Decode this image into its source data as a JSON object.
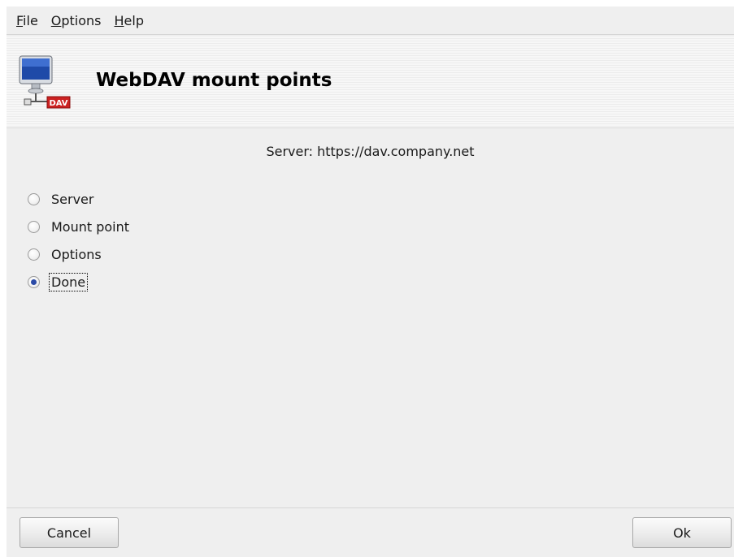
{
  "menubar": {
    "file": {
      "mnemonic": "F",
      "rest": "ile"
    },
    "options": {
      "mnemonic": "O",
      "rest": "ptions"
    },
    "help": {
      "mnemonic": "H",
      "rest": "elp"
    }
  },
  "banner": {
    "icon": "webdav-monitor-icon",
    "badge_text": "DAV",
    "title": "WebDAV mount points"
  },
  "server_line": "Server: https://dav.company.net",
  "radios": [
    {
      "label": "Server",
      "checked": false
    },
    {
      "label": "Mount point",
      "checked": false
    },
    {
      "label": "Options",
      "checked": false
    },
    {
      "label": "Done",
      "checked": true
    }
  ],
  "buttons": {
    "cancel": "Cancel",
    "ok": "Ok"
  },
  "colors": {
    "radio_selected": "#2b4aa6",
    "badge": "#cc2222"
  }
}
